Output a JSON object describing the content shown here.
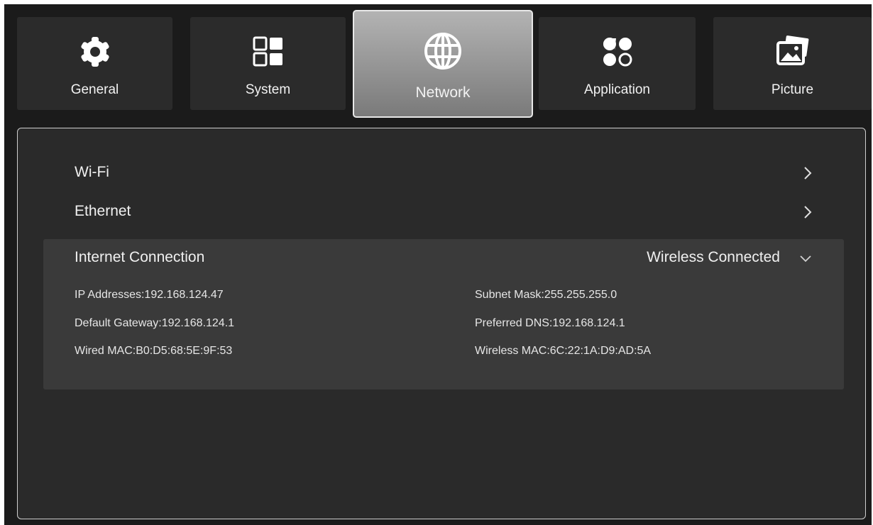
{
  "tabs": [
    {
      "label": "General",
      "icon": "gear-icon"
    },
    {
      "label": "System",
      "icon": "windows-icon"
    },
    {
      "label": "Network",
      "icon": "globe-icon",
      "active": true
    },
    {
      "label": "Application",
      "icon": "apps-icon"
    },
    {
      "label": "Picture",
      "icon": "picture-icon"
    }
  ],
  "menu": {
    "wifi_label": "Wi-Fi",
    "ethernet_label": "Ethernet"
  },
  "internet": {
    "title": "Internet Connection",
    "status": "Wireless Connected",
    "ip": "IP Addresses:192.168.124.47",
    "subnet": "Subnet Mask:255.255.255.0",
    "gateway": "Default Gateway:192.168.124.1",
    "dns": "Preferred DNS:192.168.124.1",
    "wired_mac": "Wired MAC:B0:D5:68:5E:9F:53",
    "wireless_mac": "Wireless MAC:6C:22:1A:D9:AD:5A"
  },
  "colors": {
    "background": "#1b1b1b",
    "panel": "#2a2a2a",
    "expanded_row": "#3a3a3a",
    "active_tab": "#9a9a9a"
  }
}
